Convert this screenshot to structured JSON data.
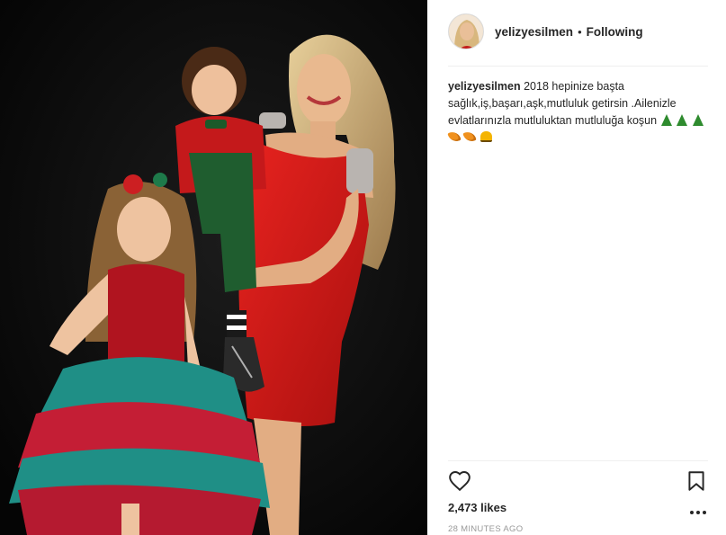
{
  "post": {
    "photo": {
      "icon": "post-photo-image",
      "description_key": "photo"
    },
    "header": {
      "username": "yelizyesilmen",
      "separator": "•",
      "follow_status": "Following"
    },
    "caption": {
      "username": "yelizyesilmen",
      "text": "2018 hepinize başta sağlık,iş,başarı,aşk,mutluluk getirsin .Ailenizle evlatlarınızla mutluluktan mutluluğa koşun",
      "emojis": [
        "christmas-tree",
        "christmas-tree",
        "christmas-tree",
        "carrot",
        "carrot",
        "bell"
      ]
    },
    "actions": {
      "like_icon": "heart-outline-icon",
      "save_icon": "bookmark-outline-icon",
      "more_icon": "ellipsis-icon"
    },
    "likes": "2,473 likes",
    "timestamp": "28 MINUTES AGO"
  },
  "colors": {
    "text": "#262626",
    "muted": "#999999",
    "divider": "#efefef",
    "photo_background": "#0b0b0b",
    "dress_red": "#d81c1c",
    "tulle_teal": "#1f8f86"
  }
}
